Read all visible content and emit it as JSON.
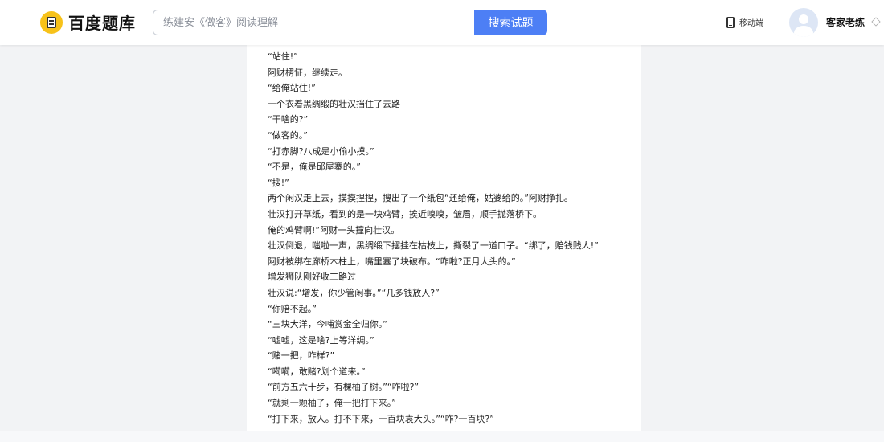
{
  "header": {
    "logo_text": "百度题库",
    "search": {
      "value": "",
      "placeholder": "练建安《做客》阅读理解",
      "button_label": "搜索试题"
    },
    "mobile_label": "移动端",
    "username": "客家老练"
  },
  "icons": {
    "logo": "baidu-tiku-logo-icon",
    "mobile": "phone-icon",
    "avatar": "user-avatar",
    "vip": "diamond-icon"
  },
  "colors": {
    "accent": "#4d7ff5",
    "logo_yellow": "#f7c21a"
  },
  "article": {
    "lines": [
      "“站住!”",
      "阿财楞怔，继续走。",
      "“给俺站住!”",
      "一个衣着黑绸缎的壮汉挡住了去路",
      "“干啥的?”",
      "“做客的。”",
      "“打赤脚?八成是小偷小摸。”",
      "“不是，俺是邱屋寨的。”",
      "“搜!”",
      "两个闲汉走上去，摸摸捏捏，搜出了一个纸包“还给俺，姑婆给的。”阿财挣扎。",
      "壮汉打开草纸，看到的是一块鸡臂，挨近嗅嗅，皱眉，顺手抛落桥下。",
      "俺的鸡臂啊!”阿财一头撞向壮汉。",
      "壮汉倒退，嗤啦一声，黑绸缎下摆挂在枯枝上，撕裂了一道口子。“绑了，赔钱贱人!”",
      "阿财被绑在廊桥木柱上，嘴里塞了块破布。“咋啦?正月大头的。”",
      "增发狮队刚好收工路过",
      "壮汉说:“增发，你少管闲事。”“几多钱放人?”",
      "“你赔不起。”",
      "“三块大洋，今哺赏金全归你。”",
      "“嘘嘘，这是啥?上等洋绸。”",
      "“赌一把，咋样?”",
      "“嗬嗬，敢赌?划个道来。”",
      "“前方五六十步，有棵柚子树。”“咋啦?”",
      "“就剩一颗柚子，俺一把打下来。”",
      "“打下来，放人。打不下来，一百块袁大头。”“咋?一百块?”"
    ]
  }
}
